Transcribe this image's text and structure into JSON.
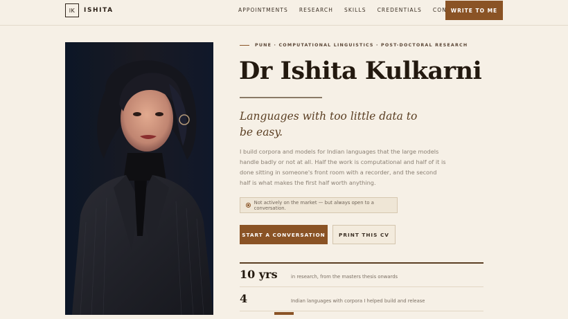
{
  "header": {
    "logo_mark": "IK",
    "logo_name": "ISHITA",
    "nav": [
      "APPOINTMENTS",
      "RESEARCH",
      "SKILLS",
      "CREDENTIALS",
      "CONTACT"
    ],
    "cta": "WRITE TO ME"
  },
  "hero": {
    "eyebrow": "PUNE · COMPUTATIONAL LINGUISTICS · POST-DOCTORAL RESEARCH",
    "title": "Dr Ishita Kulkarni",
    "tagline": "Languages with too little data to be easy.",
    "bio": "I build corpora and models for Indian languages that the large models handle badly or not at all. Half the work is computational and half of it is done sitting in someone's front room with a recorder, and the second half is what makes the first half worth anything.",
    "status": "Not actively on the market — but always open to a conversation.",
    "primary_button": "START A CONVERSATION",
    "secondary_button": "PRINT THIS CV"
  },
  "stats": [
    {
      "value": "10 yrs",
      "label": "in research, from the masters thesis onwards"
    },
    {
      "value": "4",
      "label": "Indian languages with corpora I helped build and release"
    }
  ],
  "colors": {
    "accent": "#8a5325",
    "background": "#f6f0e6",
    "text": "#2b2017"
  }
}
